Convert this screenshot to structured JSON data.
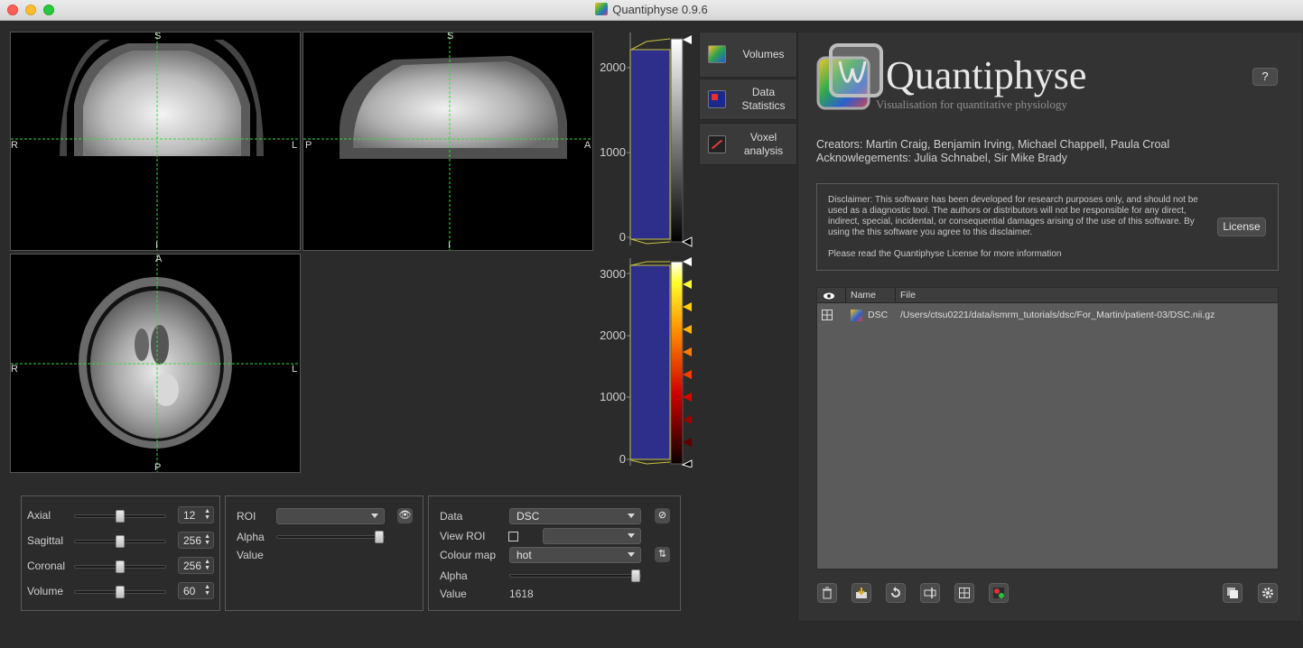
{
  "window": {
    "title": "Quantiphyse 0.9.6"
  },
  "viewers": {
    "coronal": {
      "top": "S",
      "left": "R",
      "right": "L",
      "bottom": "I"
    },
    "sagittal": {
      "top": "S",
      "left": "P",
      "right": "A",
      "bottom": "I"
    },
    "axial": {
      "top": "A",
      "left": "R",
      "right": "L",
      "bottom": "P"
    }
  },
  "colorbars": {
    "main": {
      "ticks": [
        "2000",
        "1000",
        "0"
      ]
    },
    "overlay": {
      "ticks": [
        "3000",
        "2000",
        "1000",
        "0"
      ]
    }
  },
  "side_tabs": [
    {
      "label": "Volumes",
      "icon": "volumes-icon"
    },
    {
      "label": "Data Statistics",
      "icon": "data-statistics-icon"
    },
    {
      "label": "Voxel analysis",
      "icon": "voxel-analysis-icon"
    }
  ],
  "navigation": {
    "axial": {
      "label": "Axial",
      "value": "12",
      "level": 0.5
    },
    "sagittal": {
      "label": "Sagittal",
      "value": "256",
      "level": 0.5
    },
    "coronal": {
      "label": "Coronal",
      "value": "256",
      "level": 0.5
    },
    "volume": {
      "label": "Volume",
      "value": "60",
      "level": 0.5
    }
  },
  "roi_panel": {
    "roi_label": "ROI",
    "roi_value": "",
    "alpha_label": "Alpha",
    "alpha_level": 1.0,
    "value_label": "Value"
  },
  "data_panel": {
    "data_label": "Data",
    "data_value": "DSC",
    "view_roi_label": "View ROI",
    "view_roi_value": "",
    "colour_map_label": "Colour map",
    "colour_map_value": "hot",
    "alpha_label": "Alpha",
    "alpha_level": 1.0,
    "value_label": "Value",
    "value": "1618"
  },
  "about": {
    "app_name": "Quantiphyse",
    "tagline": "Visualisation for quantitative physiology",
    "help": "?",
    "creators": "Creators: Martin Craig, Benjamin Irving, Michael Chappell, Paula Croal",
    "acknowledgements": "Acknowlegements: Julia Schnabel, Sir Mike Brady",
    "disclaimer": "Disclaimer: This software has been developed for research purposes only, and should not be used as a diagnostic tool. The authors or distributors will not be responsible for any direct, indirect, special, incidental, or consequential damages arising of the use of this software. By using the this software you agree to this disclaimer.",
    "read_license": "Please read the Quantiphyse License for more information",
    "license_button": "License"
  },
  "data_table": {
    "columns": [
      "Name",
      "File"
    ],
    "rows": [
      {
        "name": "DSC",
        "file": "/Users/ctsu0221/data/ismrm_tutorials/dsc/For_Martin/patient-03/DSC.nii.gz"
      }
    ]
  },
  "toolbar_icons": [
    "delete-icon",
    "save-icon",
    "reset-icon",
    "rename-icon",
    "grid-icon",
    "roi-icon",
    "overlay-icon",
    "settings-icon"
  ],
  "colors": {
    "crosshair": "#3ad83a",
    "histogram": "#2d2f8a",
    "background": "#2b2b2b"
  }
}
